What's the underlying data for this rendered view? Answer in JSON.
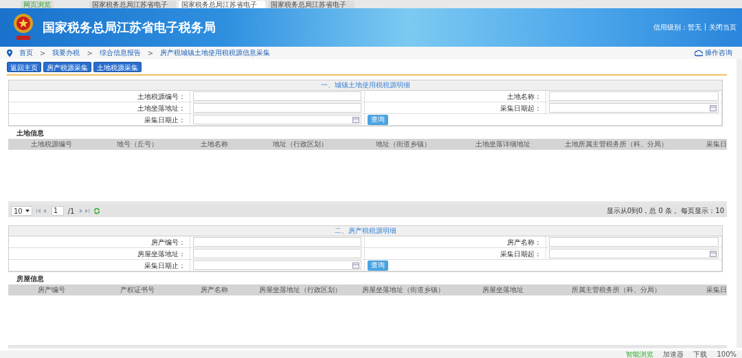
{
  "browser_tabs": [
    {
      "label": "网页浏览",
      "selected": false
    },
    {
      "label": "国家税务总局江苏省电子",
      "selected": false
    },
    {
      "label": "国家税务总局江苏省电子",
      "selected": true
    },
    {
      "label": "国家税务总局江苏省电子",
      "selected": false
    }
  ],
  "header": {
    "title": "国家税务总局江苏省电子税务局",
    "credit": "信用级别：暂无",
    "separator": "|",
    "close_link": "关闭当页"
  },
  "breadcrumb": [
    "首页",
    "我要办税",
    "综合信息报告",
    "房产税城镇土地使用税税源信息采集"
  ],
  "breadcrumb_separators": [
    ">",
    ">",
    ">"
  ],
  "help_link": "操作咨询",
  "buttons": [
    "返回主页",
    "房产税源采集",
    "土地税源采集"
  ],
  "sections": [
    {
      "title": "一、城镇土地使用税税源明细",
      "fields": [
        {
          "label": "土地税源编号：",
          "kind": "text"
        },
        {
          "label": "土地名称：",
          "kind": "text"
        },
        {
          "label": "土地坐落地址：",
          "kind": "text"
        },
        {
          "label": "采集日期起：",
          "kind": "date"
        },
        {
          "label": "采集日期止：",
          "kind": "date"
        },
        {
          "button": "查询",
          "kind": "button"
        }
      ],
      "list_title": "土地信息",
      "columns": [
        "土地税源编号",
        "地号（丘号）",
        "土地名称",
        "地址（行政区划）",
        "地址（街道乡镇）",
        "土地坐落详细地址",
        "土地所属主管税务所（科、分局）",
        "采集日"
      ],
      "pagination": {
        "page_size": "10",
        "page": "1",
        "total": "/1",
        "summary": "显示从0到0，总 0 条 。每页显示：10"
      }
    },
    {
      "title": "二、房产税税源明细",
      "fields": [
        {
          "label": "房产编号：",
          "kind": "text"
        },
        {
          "label": "房产名称：",
          "kind": "text"
        },
        {
          "label": "房屋坐落地址：",
          "kind": "text"
        },
        {
          "label": "采集日期起：",
          "kind": "date"
        },
        {
          "label": "采集日期止：",
          "kind": "date"
        },
        {
          "button": "查询",
          "kind": "button"
        }
      ],
      "list_title": "房屋信息",
      "columns": [
        "房产编号",
        "产权证书号",
        "房产名称",
        "房屋坐落地址（行政区划）",
        "房屋坐落地址（街道乡镇）",
        "房屋坐落地址",
        "所属主管税务所（科、分局）",
        "采集日"
      ]
    }
  ],
  "status_bar": [
    "智能浏览",
    "加速器",
    "下载",
    "100%"
  ]
}
